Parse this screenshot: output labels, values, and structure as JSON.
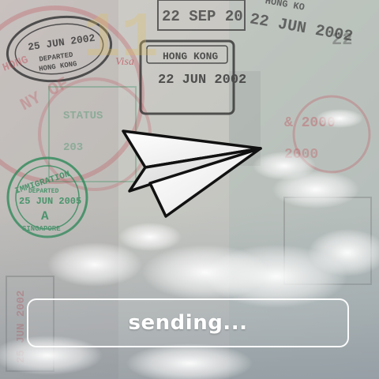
{
  "background": {
    "name": "passport-stamps-sky-background",
    "stamps": [
      {
        "id": "stamp-top-left",
        "lines": [
          "25 JUN 2002",
          "DEPARTED",
          "HONG KONG"
        ]
      },
      {
        "id": "stamp-hong-kong",
        "lines": [
          "HONG KONG",
          "22 JUN 2002"
        ]
      },
      {
        "id": "stamp-top-date",
        "lines": [
          "22 SEP 20"
        ]
      },
      {
        "id": "stamp-top-right",
        "lines": [
          "HONG KO",
          "22 JUN 2002"
        ]
      },
      {
        "id": "stamp-immigration",
        "lines": [
          "IMMIGRATION",
          "DEPARTED",
          "25 JUN 2005",
          "A",
          "SINGAPORE"
        ]
      },
      {
        "id": "stamp-visa",
        "lines": [
          "Visa"
        ]
      },
      {
        "id": "stamp-vertical",
        "lines": [
          "25 JUN 2002"
        ]
      }
    ]
  },
  "icon": {
    "name": "paper-plane-icon"
  },
  "status": {
    "label": "sending..."
  },
  "colors": {
    "status_border": "#ffffff",
    "status_text": "#ffffff",
    "stamp_red": "#c0505a",
    "stamp_green": "#2f8a5a",
    "stamp_black": "#3a3a3a"
  }
}
